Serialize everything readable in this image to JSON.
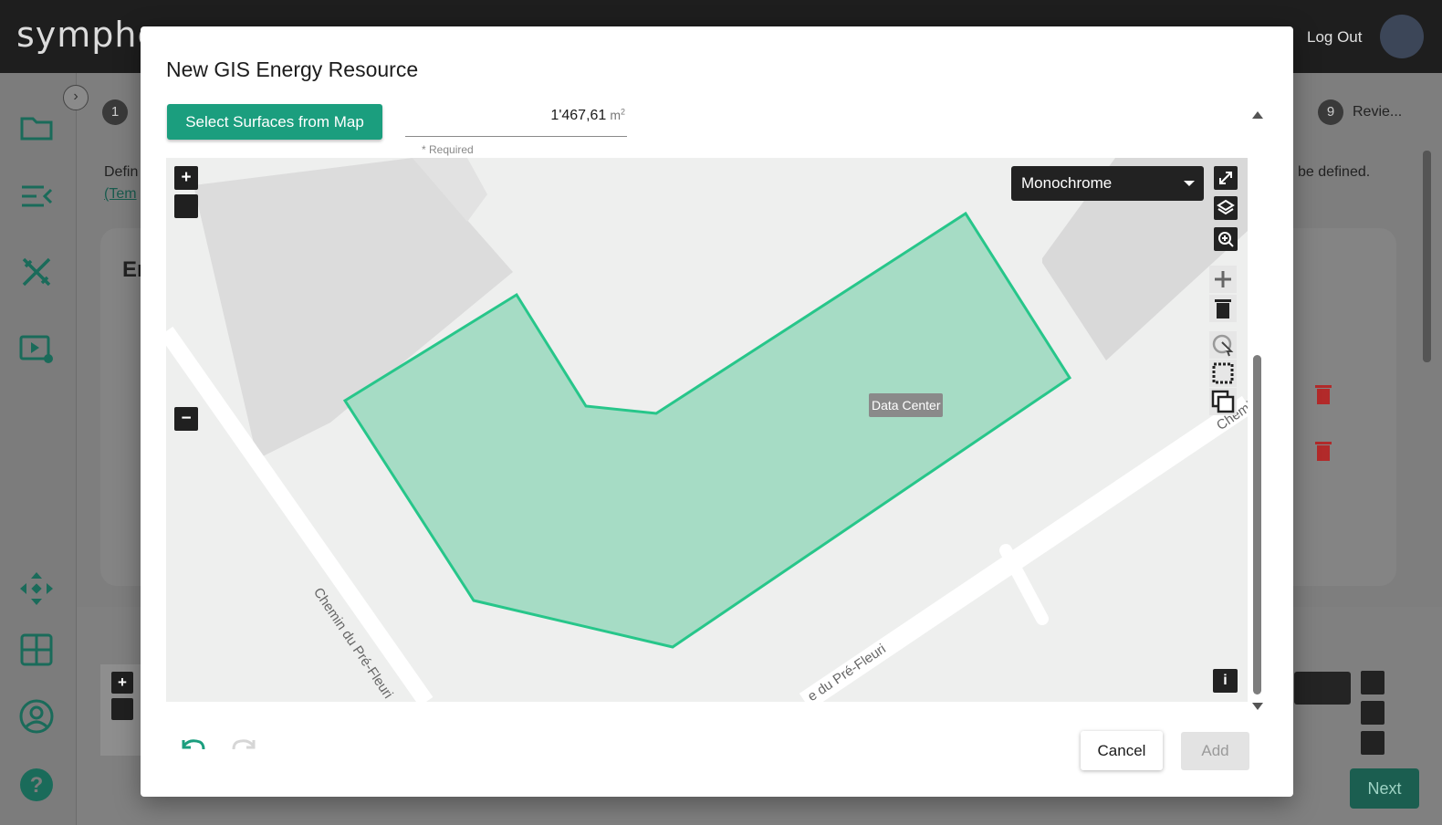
{
  "app": {
    "logo_text": "symphe",
    "logout_label": "Log Out"
  },
  "background": {
    "step_first_number": "1",
    "step_last_number": "9",
    "step_last_label": "Revie...",
    "intro_text": "Defin",
    "intro_link": "(Tem",
    "intro_text_right": "be defined.",
    "card_title_fragment": "Er",
    "next_label": "Next",
    "zoom_in_label": "+"
  },
  "modal": {
    "title": "New GIS Energy Resource",
    "select_button_label": "Select Surfaces from Map",
    "area": {
      "value": "1'467,61",
      "unit": "m",
      "unit_power": "2",
      "helper": "* Required"
    },
    "map": {
      "basemap_selected": "Monochrome",
      "zoom_in_label": "+",
      "zoom_out_label": "−",
      "info_label": "i",
      "polygon_label": "Data Center",
      "street_left": "Chemin du Pré-Fleuri",
      "street_bottom": "e du Pré-Fleuri",
      "street_right": "Chemi",
      "polygon_fill": "#a6dcc5",
      "polygon_stroke": "#27c68a"
    },
    "cancel_label": "Cancel",
    "add_label": "Add"
  },
  "colors": {
    "accent": "#1b9e7e",
    "danger": "#c62828",
    "topbar": "#1e1e1e"
  },
  "icons": {
    "sidebar": [
      "folder-icon",
      "list-collapse-icon",
      "tools-icon",
      "video-settings-icon",
      "move-icon",
      "grid-icon",
      "account-icon",
      "help-icon"
    ],
    "map_controls": [
      "fullscreen-icon",
      "layers-icon",
      "zoom-search-icon"
    ],
    "draw_controls": [
      "draw-polygon-icon",
      "delete-icon",
      "select-icon",
      "box-select-icon",
      "copy-layers-icon"
    ]
  }
}
